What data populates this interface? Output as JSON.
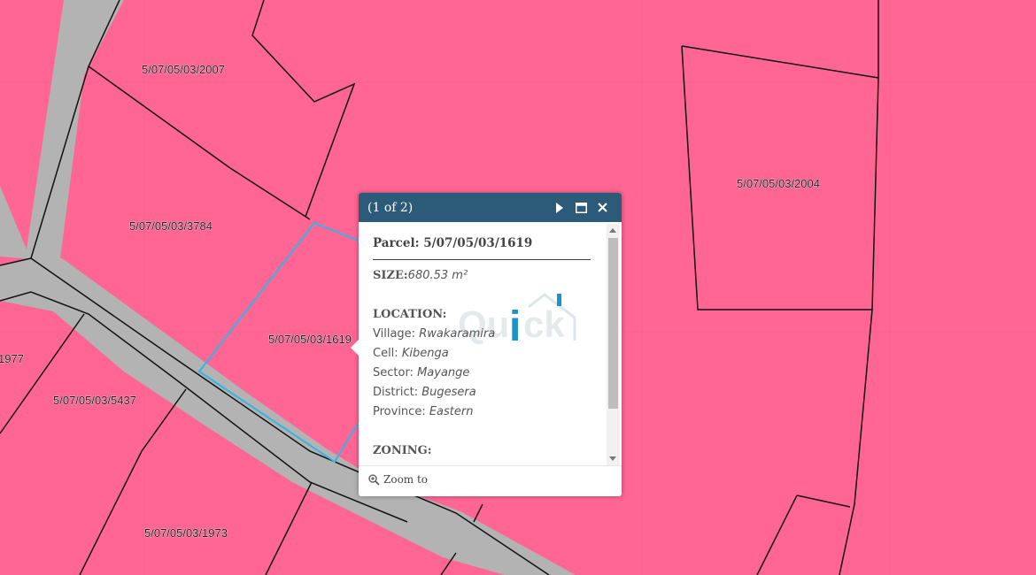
{
  "map": {
    "background_color": "#ff6694",
    "road_color": "#b3b3b3",
    "parcel_line_color": "#111111",
    "selected_parcel_color": "#33b5e5",
    "parcel_labels": [
      "5/07/05/03/2007",
      "5/07/05/03/3784",
      "5/07/05/03/1619",
      "5/07/05/03/2004",
      "1977",
      "5/07/05/03/5437",
      "5/07/05/03/1973"
    ]
  },
  "popup": {
    "header_color": "#2b5b78",
    "count": "(1 of 2)",
    "next_icon": "triangle-right-icon",
    "maximize_icon": "maximize-icon",
    "close_icon": "close-icon",
    "parcel_label": "Parcel: 5/07/05/03/1619",
    "size_label": "SIZE:",
    "size_value": "680.53 m²",
    "location_heading": "LOCATION:",
    "location": [
      {
        "label": "Village:",
        "value": "Rwakaramira"
      },
      {
        "label": "Cell:",
        "value": "Kibenga"
      },
      {
        "label": "Sector:",
        "value": "Mayange"
      },
      {
        "label": "District:",
        "value": "Bugesera"
      },
      {
        "label": "Province:",
        "value": "Eastern"
      }
    ],
    "zoning_heading": "ZONING:",
    "zoom_label": "Zoom to",
    "zoom_icon": "magnifier-plus-icon",
    "watermark": "Quick"
  }
}
